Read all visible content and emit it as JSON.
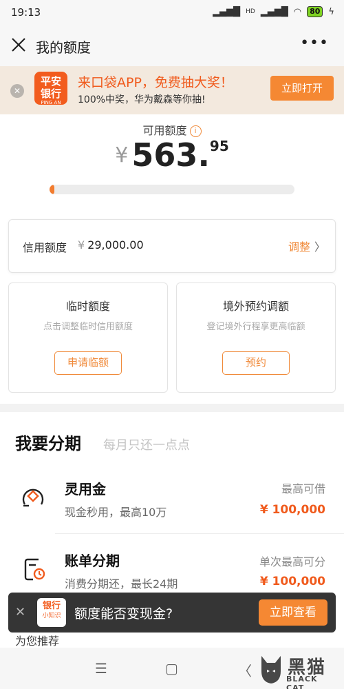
{
  "status_bar": {
    "time": "19:13",
    "signal": "HD",
    "battery": "80"
  },
  "nav": {
    "title": "我的额度"
  },
  "ad": {
    "logo_line1": "平安",
    "logo_line2": "银行",
    "logo_sub": "PING AN",
    "headline": "来口袋APP，免费抽大奖！",
    "subline": "100%中奖，华为戴森等你抽!",
    "button": "立即打开"
  },
  "balance": {
    "label": "可用额度",
    "currency": "¥",
    "integer": "563.",
    "decimal": "95",
    "progress_fraction": 0.019
  },
  "credit": {
    "label": "信用额度",
    "currency": "¥",
    "value": "29,000.00",
    "adjust": "调整"
  },
  "temp_card": {
    "title": "临时额度",
    "subtitle": "点击调整临时信用额度",
    "button": "申请临额"
  },
  "overseas_card": {
    "title": "境外预约调额",
    "subtitle": "登记境外行程享更高临额",
    "button": "预约"
  },
  "installments": {
    "title": "我要分期",
    "subtitle": "每月只还一点点",
    "items": [
      {
        "title": "灵用金",
        "desc": "现金秒用，最高10万",
        "right_label": "最高可借",
        "amount": "¥ 100,000",
        "icon": "coin-icon"
      },
      {
        "title": "账单分期",
        "desc": "消费分期还，最长24期",
        "right_label": "单次最高可分",
        "amount": "¥ 100,000",
        "icon": "bill-clock-icon"
      }
    ]
  },
  "toast": {
    "logo_line1": "银行",
    "logo_line2": "小知识",
    "message": "额度能否变现金?",
    "button": "立即查看"
  },
  "recommend": {
    "label": "为您推荐"
  },
  "watermark": {
    "line1": "黑猫",
    "line2": "BLACK CAT"
  },
  "colors": {
    "accent": "#f05a1c",
    "button": "#f58833",
    "progress": "#f27c2f"
  }
}
